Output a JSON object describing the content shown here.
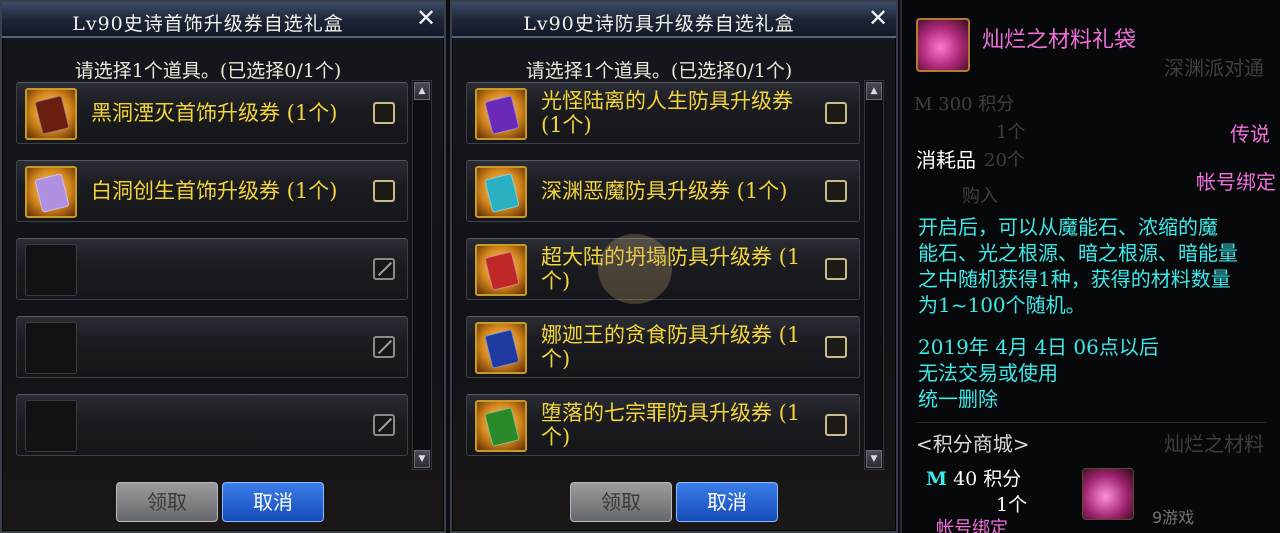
{
  "dialog_accessory": {
    "title": "Lv90史诗首饰升级券自选礼盒",
    "prompt": "请选择1个道具。(已选择0/1个)",
    "items": [
      {
        "label": "黑洞湮灭首饰升级券 (1个)",
        "card_color": "#6a1e10"
      },
      {
        "label": "白洞创生首饰升级券 (1个)",
        "card_color": "#b090e0"
      },
      {
        "label": "",
        "empty": true
      },
      {
        "label": "",
        "empty": true
      },
      {
        "label": "",
        "empty": true
      }
    ],
    "buttons": {
      "take": "领取",
      "cancel": "取消"
    }
  },
  "dialog_armor": {
    "title": "Lv90史诗防具升级券自选礼盒",
    "prompt": "请选择1个道具。(已选择0/1个)",
    "items": [
      {
        "label": "光怪陆离的人生防具升级券 (1个)",
        "card_color": "#6a2ab8"
      },
      {
        "label": "深渊恶魔防具升级券 (1个)",
        "card_color": "#2ab0c0"
      },
      {
        "label": "超大陆的坍塌防具升级券 (1个)",
        "card_color": "#c02828"
      },
      {
        "label": "娜迦王的贪食防具升级券 (1个)",
        "card_color": "#1e3aa0"
      },
      {
        "label": "堕落的七宗罪防具升级券 (1个)",
        "card_color": "#2a8a2a"
      }
    ],
    "buttons": {
      "take": "领取",
      "cancel": "取消"
    }
  },
  "tooltip": {
    "name": "灿烂之材料礼袋",
    "grade": "传说",
    "category": "消耗品",
    "binding": "帐号绑定",
    "description": "开启后，可以从魔能石、浓缩的魔能石、光之根源、暗之根源、暗能量之中随机获得1种，获得的材料数量为1~100个随机。",
    "desc_lines": [
      "开启后，可以从魔能石、浓缩的魔",
      "能石、光之根源、暗之根源、暗能量",
      "之中随机获得1种，获得的材料数量",
      "为1~100个随机。"
    ],
    "date_lines": [
      "2019年 4月 4日 06点以后",
      "无法交易或使用",
      "统一删除"
    ],
    "mall_label": "<积分商城>",
    "price_symbol": "M",
    "price_value": "40 积分",
    "quantity": "1个",
    "bottom_binding": "帐号绑定",
    "ghost": {
      "top_right": "深渊派对通",
      "points": "M 300 积分",
      "qty": "1个",
      "qty2": "20个",
      "buy": "购入",
      "pack": "灿烂之材料"
    },
    "watermark": "9游戏"
  }
}
